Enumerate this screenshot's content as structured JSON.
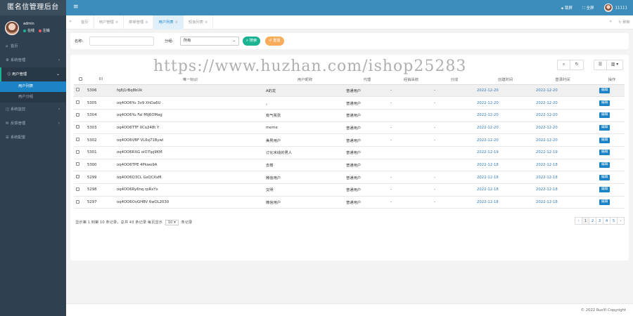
{
  "app": {
    "title": "匿名信管理后台"
  },
  "user": {
    "name": "admin",
    "online": "在线",
    "logout": "注销"
  },
  "colors": {
    "sidebar": "#2f4050",
    "topbar": "#3c8dbc",
    "accent": "#1c84c6",
    "success": "#1ab394"
  },
  "sidebar": {
    "items": [
      {
        "label": "首页",
        "icon": "home-icon"
      },
      {
        "label": "系统管理",
        "icon": "gear-icon",
        "chevron": "‹"
      },
      {
        "label": "用户管理",
        "icon": "user-icon",
        "chevron": "⌄",
        "active": true
      },
      {
        "label": "系统监控",
        "icon": "monitor-icon",
        "chevron": "‹"
      },
      {
        "label": "反馈管理",
        "icon": "chat-icon",
        "chevron": "‹"
      },
      {
        "label": "系统配置",
        "icon": "config-icon"
      }
    ],
    "subitems": [
      {
        "label": "用户列表",
        "active": true
      },
      {
        "label": "用户分组"
      }
    ]
  },
  "topbar": {
    "menu_icon": "≡",
    "lock": "锁屏",
    "fullscreen": "全屏",
    "username": "11111"
  },
  "tabs": {
    "items": [
      {
        "label": "首页"
      },
      {
        "label": "用户管理"
      },
      {
        "label": "菜单管理"
      },
      {
        "label": "用户列表",
        "active": true
      },
      {
        "label": "短信列表"
      }
    ],
    "refresh": "刷新"
  },
  "search": {
    "name_label": "名称:",
    "group_label": "分组:",
    "group_value": "所有",
    "search_btn": "搜索",
    "reset_btn": "重置"
  },
  "table": {
    "headers": [
      "",
      "ID",
      "唯一标识",
      "用户昵称",
      "代理",
      "经销采统",
      "分成",
      "创建时间",
      "登录时间",
      "操作"
    ],
    "rows": [
      {
        "id": "5306",
        "ident": "fq8j1rBq8bUk",
        "nick": "A的龙",
        "role": "普通用户",
        "dist": "-",
        "share": "-",
        "created": "2022-12-20",
        "login": "2022-12-20",
        "op": "编辑",
        "selected": true
      },
      {
        "id": "5305",
        "ident": "oq4OO6Yu 3v9 XhDa6U",
        "nick": "。",
        "role": "普通用户",
        "dist": "-",
        "share": "-",
        "created": "2022-12-20",
        "login": "2022-12-20",
        "op": "编辑"
      },
      {
        "id": "5304",
        "ident": "oq4OO6Yu Fal MIJ6OMag",
        "nick": "有气氛张",
        "role": "普通用户",
        "dist": "",
        "share": "",
        "created": "2022-12-20",
        "login": "2022-12-20",
        "op": "编辑"
      },
      {
        "id": "5303",
        "ident": "oq4OO6TTF 0Ce248t Y",
        "nick": "meme",
        "role": "普通用户",
        "dist": "-",
        "share": "-",
        "created": "2022-12-20",
        "login": "2022-12-20",
        "op": "编辑"
      },
      {
        "id": "5302",
        "ident": "oq4OO6VBF VL6q71Bywl",
        "nick": "美男用户",
        "role": "普通用户",
        "dist": "-",
        "share": "-",
        "created": "2022-12-20",
        "login": "2022-12-20",
        "op": "编辑"
      },
      {
        "id": "5301",
        "ident": "oq4OO6RXG oiO7lpj9KM",
        "nick": "订化米线的男人",
        "role": "普通用户",
        "dist": "",
        "share": "",
        "created": "2022-12-19",
        "login": "2022-12-19",
        "op": "编辑"
      },
      {
        "id": "5300",
        "ident": "oq4OO6TPE 4Pkwe9A",
        "nick": "去楼",
        "role": "普通用户",
        "dist": "",
        "share": "",
        "created": "2022-12-18",
        "login": "2022-12-18",
        "op": "编辑"
      },
      {
        "id": "5299",
        "ident": "oq4OO6Q3CL GsQCXxM",
        "nick": "微信用户",
        "role": "普通用户",
        "dist": "-",
        "share": "-",
        "created": "2022-12-18",
        "login": "2022-12-18",
        "op": "编辑"
      },
      {
        "id": "5298",
        "ident": "oq4OO6Ry6nq rpRxYx",
        "nick": "文明",
        "role": "普通用户",
        "dist": "-",
        "share": "-",
        "created": "2022-12-18",
        "login": "2022-12-18",
        "op": "编辑"
      },
      {
        "id": "5297",
        "ident": "oq4OO6OvGHBV 6wOL2030",
        "nick": "微信用户",
        "role": "普通用户",
        "dist": "-",
        "share": "-",
        "created": "2022-12-18",
        "login": "2022-12-18",
        "op": "编辑"
      }
    ]
  },
  "pagination": {
    "info": "显示第 1 到第 10 条记录，总共 43 条记录 每页显示",
    "page_size": "10",
    "info_suffix": "条记录",
    "prev": "‹",
    "pages": [
      "1",
      "2",
      "3",
      "4",
      "5"
    ],
    "next": "›"
  },
  "watermark": "https://www.huzhan.com/ishop25283",
  "copyright": "© 2022 RuoYi Copyright"
}
